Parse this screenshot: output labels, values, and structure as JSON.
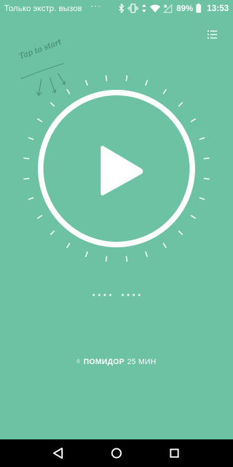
{
  "status_bar": {
    "carrier": "Только экстр. вызов",
    "more": "···",
    "battery": "89%",
    "time": "13:53",
    "icons": [
      "bluetooth-icon",
      "vibrate-icon",
      "data-arrows-icon",
      "wifi-icon",
      "no-signal-icon",
      "battery-icon"
    ]
  },
  "toolbar": {
    "menu_icon": "list-icon"
  },
  "hint": {
    "text": "Tap to start"
  },
  "timer": {
    "control_icon": "play-icon",
    "ring_color": "#ffffff",
    "tick_color": "#ffffff"
  },
  "pager": {
    "groups": 2,
    "dots_per_group": 4
  },
  "mode": {
    "switch_icon": "up-down-chevron-icon",
    "name": "ПОМИДОР",
    "duration": "25 МИН"
  },
  "navbar": {
    "back_icon": "back-triangle-icon",
    "home_icon": "home-circle-icon",
    "recents_icon": "recents-square-icon"
  },
  "colors": {
    "background": "#6cc2a2",
    "accent": "#ffffff",
    "navbar": "#000000"
  }
}
